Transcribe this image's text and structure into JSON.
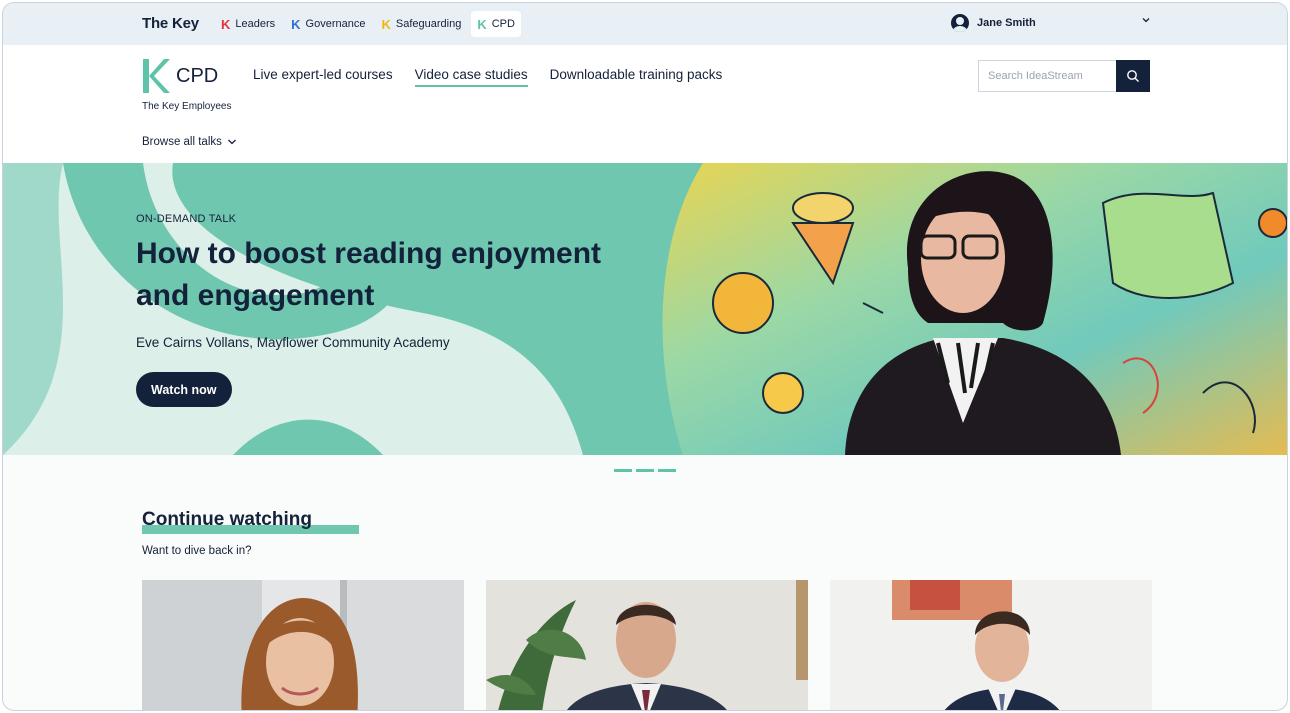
{
  "topbar": {
    "brand": "The Key",
    "nav": [
      {
        "label": "Leaders",
        "icon": "k-logo-icon",
        "color": "#e5333d"
      },
      {
        "label": "Governance",
        "icon": "k-logo-icon",
        "color": "#2f6fd8"
      },
      {
        "label": "Safeguarding",
        "icon": "k-logo-icon",
        "color": "#f2b417"
      },
      {
        "label": "CPD",
        "icon": "k-logo-icon",
        "color": "#5fc3aa",
        "active": true
      }
    ],
    "user_name": "Jane Smith",
    "user_icon": "user-avatar-icon",
    "user_menu_icon": "chevron-down-icon"
  },
  "header": {
    "logo_text": "CPD",
    "logo_subtitle": "The Key Employees",
    "nav": [
      {
        "label": "Live expert-led courses"
      },
      {
        "label": "Video case studies",
        "active": true
      },
      {
        "label": "Downloadable training packs"
      }
    ],
    "search_placeholder": "Search IdeaStream",
    "search_icon": "search-icon",
    "browse_label": "Browse all talks",
    "browse_icon": "chevron-down-icon"
  },
  "hero": {
    "tag": "ON-DEMAND TALK",
    "title": "How to boost reading enjoyment and engagement",
    "speaker": "Eve Cairns Vollans, Mayflower Community Academy",
    "cta": "Watch now",
    "slides": 3,
    "active_slide": 3
  },
  "continue_watching": {
    "title": "Continue watching",
    "subtitle": "Want to dive back in?",
    "cards": [
      {
        "thumbnail": "video-thumbnail"
      },
      {
        "thumbnail": "video-thumbnail"
      },
      {
        "thumbnail": "video-thumbnail"
      }
    ]
  },
  "colors": {
    "navy": "#14213a",
    "teal": "#6fc7b0",
    "accent": "#5fc3aa",
    "topbar_bg": "#e9f0f5"
  }
}
